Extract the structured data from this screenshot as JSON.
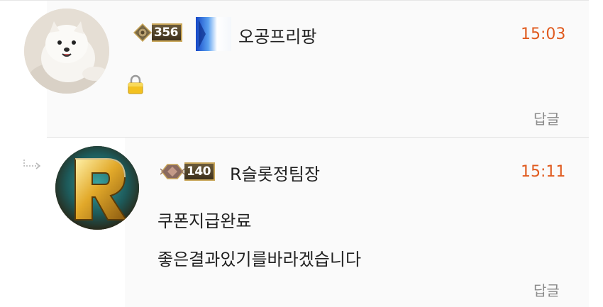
{
  "comments": [
    {
      "level": "356",
      "username": "오공프리팡",
      "time": "15:03",
      "reply_label": "답글",
      "avatar_icon": "pomeranian-dog-avatar",
      "lock_icon": "lock-icon",
      "accent_color": "#e05a1e"
    },
    {
      "level": "140",
      "username": "R슬롯정팀장",
      "time": "15:11",
      "reply_label": "답글",
      "avatar_icon": "gold-letter-r-avatar",
      "reply_arrow_icon": "reply-arrow-icon",
      "message_lines": [
        "쿠폰지급완료",
        "좋은결과있기를바라겠습니다"
      ],
      "accent_color": "#e05a1e"
    }
  ]
}
